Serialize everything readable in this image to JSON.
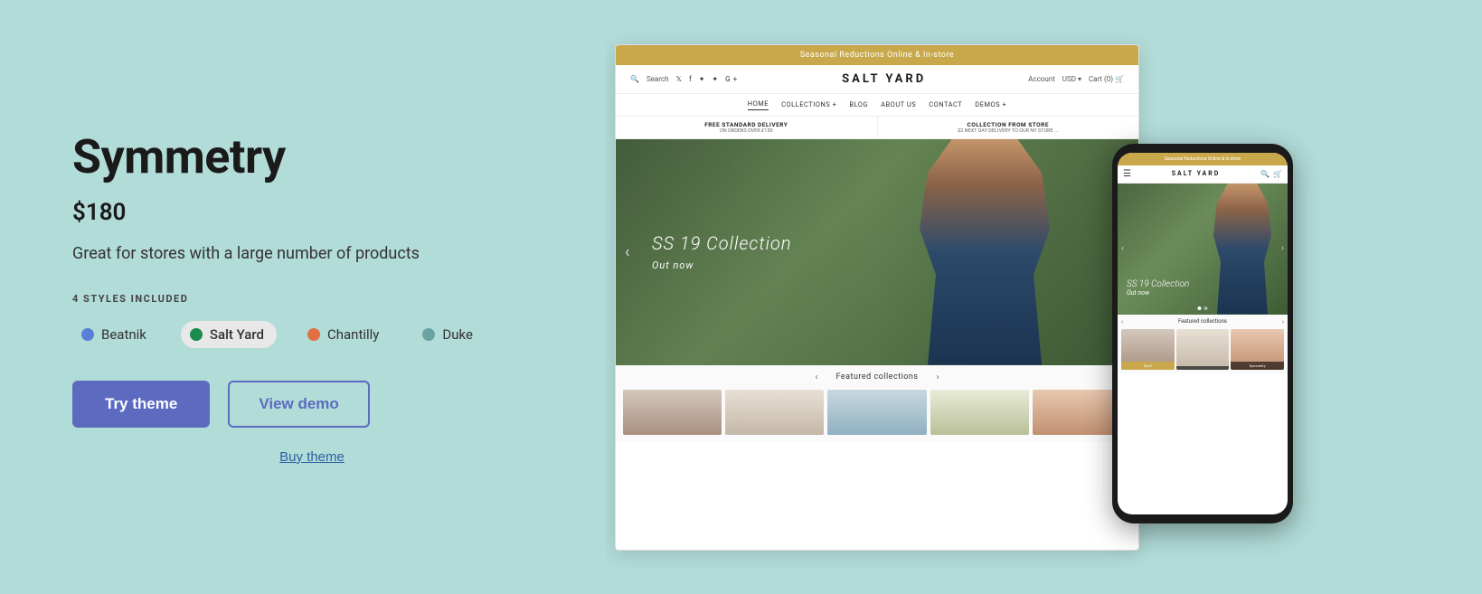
{
  "left": {
    "title": "Symmetry",
    "price": "$180",
    "description": "Great for stores with a large number of products",
    "styles_label": "4 STYLES INCLUDED",
    "styles": [
      {
        "name": "Beatnik",
        "color_class": "dot-blue",
        "active": false
      },
      {
        "name": "Salt Yard",
        "color_class": "dot-green",
        "active": true
      },
      {
        "name": "Chantilly",
        "color_class": "dot-orange",
        "active": false
      },
      {
        "name": "Duke",
        "color_class": "dot-teal",
        "active": false
      }
    ],
    "try_button": "Try theme",
    "demo_button": "View demo",
    "buy_link": "Buy theme"
  },
  "preview": {
    "top_bar": "Seasonal Reductions Online & In-store",
    "search_label": "Search",
    "logo": "SALT YARD",
    "nav": [
      "HOME",
      "COLLECTIONS +",
      "BLOG",
      "ABOUT US",
      "CONTACT",
      "DEMOS +"
    ],
    "delivery1_title": "FREE STANDARD DELIVERY",
    "delivery1_sub": "ON ORDERS OVER £150",
    "delivery2_title": "COLLECTION FROM STORE",
    "delivery2_sub": "$2 NEXT DAY DELIVERY TO OUR NY STORE ...",
    "hero_title": "SS 19 Collection",
    "hero_sub": "Out now",
    "collections_title": "Featured collections"
  },
  "mobile": {
    "top_bar": "Seasonal Reductions Online & In-store",
    "logo": "SALT YARD",
    "hero_title": "SS 19 Collection",
    "hero_sub": "Out now",
    "collections_title": "Featured collections",
    "badge1": "SALE",
    "badge2": "Symmetry"
  }
}
